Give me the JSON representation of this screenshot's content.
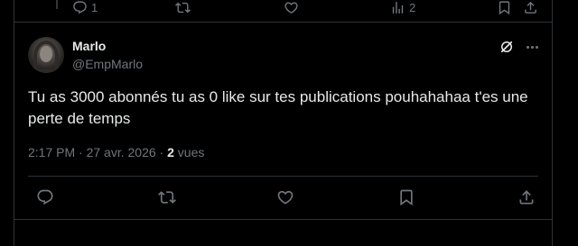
{
  "previous_post": {
    "reply_count": "1",
    "views_count": "2"
  },
  "post": {
    "author_name": "Marlo",
    "author_handle": "@EmpMarlo",
    "text": "Tu as 3000 abonnés tu as 0 like sur tes publications pouhahahaa t'es une perte de temps",
    "time": "2:17 PM",
    "separator": " · ",
    "date": "27 avr. 2026",
    "views_count": "2",
    "views_label": " vues"
  },
  "colors": {
    "background": "#000000",
    "text_primary": "#e7e9ea",
    "text_secondary": "#71767b",
    "border": "#2f3336"
  },
  "icons": {
    "reply": "reply-icon",
    "repost": "repost-icon",
    "like": "like-icon",
    "views": "views-icon",
    "bookmark": "bookmark-icon",
    "share": "share-icon",
    "grok": "grok-icon",
    "more": "more-icon"
  }
}
